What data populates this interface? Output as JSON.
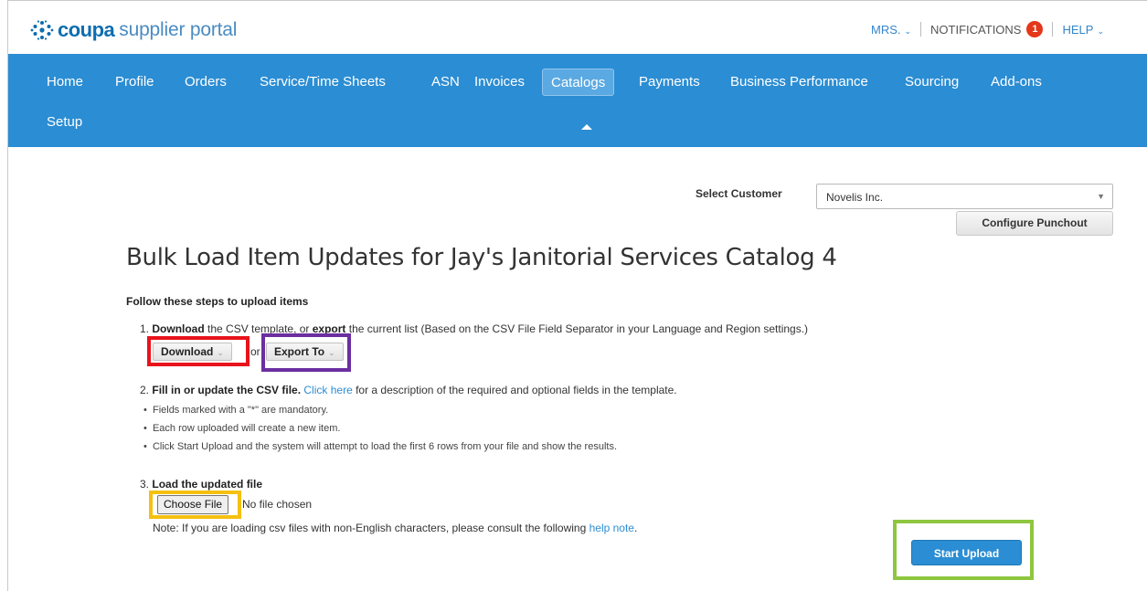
{
  "header": {
    "brand": "coupa",
    "product": "supplier portal",
    "user_menu": "MRS.",
    "notifications_label": "NOTIFICATIONS",
    "notifications_count": "1",
    "help_label": "HELP"
  },
  "nav": {
    "items": [
      "Home",
      "Profile",
      "Orders",
      "Service/Time Sheets",
      "ASN",
      "Invoices",
      "Catalogs",
      "Payments",
      "Business Performance",
      "Sourcing",
      "Add-ons",
      "Setup"
    ],
    "active": "Catalogs"
  },
  "customer": {
    "label": "Select Customer",
    "value": "Novelis Inc.",
    "configure_label": "Configure Punchout"
  },
  "page": {
    "title": "Bulk Load Item Updates for Jay's Janitorial Services Catalog 4",
    "steps_heading": "Follow these steps to upload items"
  },
  "step1": {
    "num": "1.",
    "download_bold": "Download",
    "text_a": " the CSV template, or ",
    "export_bold": "export",
    "text_b": " the current list (Based on the CSV File Field Separator in your Language and Region settings.)",
    "download_button": "Download",
    "or_text": "or",
    "export_button": "Export To"
  },
  "step2": {
    "num": "2.",
    "bold": "Fill in or update the CSV file.",
    "link": "Click here",
    "text": " for a description of the required and optional fields in the template.",
    "bullets": [
      "Fields marked with a \"*\" are mandatory.",
      "Each row uploaded will create a new item.",
      "Click Start Upload and the system will attempt to load the first 6 rows from your file and show the results."
    ]
  },
  "step3": {
    "num": "3.",
    "bold": "Load the updated file",
    "choose_button": "Choose File",
    "no_file": "No file chosen",
    "note_text": "Note: If you are loading csv files with non-English characters, please consult the following ",
    "note_link": "help note",
    "note_end": "."
  },
  "actions": {
    "start_upload": "Start Upload"
  },
  "colors": {
    "nav_bg": "#2b8dd3",
    "accent": "#2b8dd3",
    "highlight_red": "#e8131b",
    "highlight_purple": "#6b2fa0",
    "highlight_yellow": "#f5c010",
    "highlight_green": "#8fc63f"
  }
}
